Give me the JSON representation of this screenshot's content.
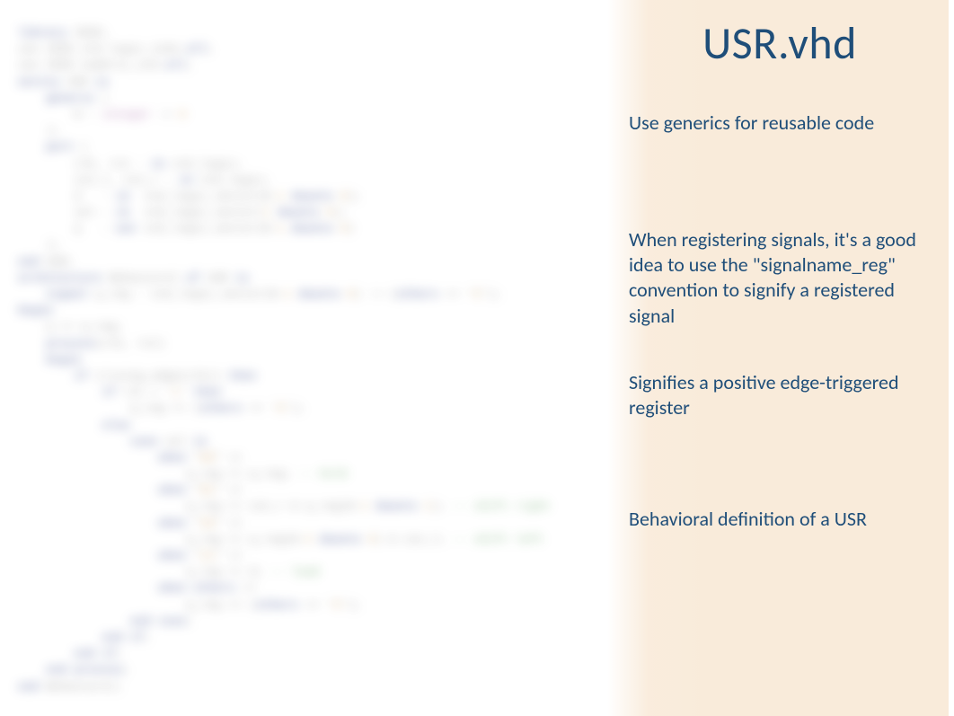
{
  "slide": {
    "title": "USR.vhd",
    "notes": [
      "Use generics for reusable code",
      "When registering signals, it's a good idea to use the \"signalname_reg\" convention to signify a registered signal",
      "Signifies a positive edge-triggered register",
      "Behavioral definition of a USR"
    ]
  },
  "code_blur": {
    "lines": [
      {
        "indent": 0,
        "segs": [
          {
            "t": "library",
            "c": "kw"
          },
          {
            "t": " IEEE;",
            "c": ""
          }
        ]
      },
      {
        "indent": 0,
        "segs": [
          {
            "t": "use IEEE.std_logic_1164.",
            "c": ""
          },
          {
            "t": "all",
            "c": "kw"
          },
          {
            "t": ";",
            "c": ""
          }
        ]
      },
      {
        "indent": 0,
        "segs": [
          {
            "t": "use IEEE.numeric_std.",
            "c": ""
          },
          {
            "t": "all",
            "c": "kw"
          },
          {
            "t": ";",
            "c": ""
          }
        ]
      },
      {
        "indent": 0,
        "segs": [
          {
            "t": "",
            "c": ""
          }
        ]
      },
      {
        "indent": 0,
        "segs": [
          {
            "t": "entity",
            "c": "kw"
          },
          {
            "t": " USR ",
            "c": ""
          },
          {
            "t": "is",
            "c": "kw"
          }
        ]
      },
      {
        "indent": 2,
        "segs": [
          {
            "t": "generic",
            "c": "kw"
          },
          {
            "t": " (",
            "c": ""
          }
        ]
      },
      {
        "indent": 4,
        "segs": [
          {
            "t": "N : ",
            "c": ""
          },
          {
            "t": "integer",
            "c": "type"
          },
          {
            "t": " := ",
            "c": ""
          },
          {
            "t": "8",
            "c": "num"
          }
        ]
      },
      {
        "indent": 2,
        "segs": [
          {
            "t": ");",
            "c": ""
          }
        ]
      },
      {
        "indent": 2,
        "segs": [
          {
            "t": "port",
            "c": "kw"
          },
          {
            "t": " (",
            "c": ""
          }
        ]
      },
      {
        "indent": 4,
        "segs": [
          {
            "t": "clk, rst : ",
            "c": ""
          },
          {
            "t": "in",
            "c": "kw"
          },
          {
            "t": " std_logic;",
            "c": ""
          }
        ]
      },
      {
        "indent": 4,
        "segs": [
          {
            "t": "sin_l, sin_r : ",
            "c": ""
          },
          {
            "t": "in",
            "c": "kw"
          },
          {
            "t": " std_logic;",
            "c": ""
          }
        ]
      },
      {
        "indent": 4,
        "segs": [
          {
            "t": "d   : ",
            "c": ""
          },
          {
            "t": "in",
            "c": "kw"
          },
          {
            "t": "  std_logic_vector(N-",
            "c": ""
          },
          {
            "t": "1",
            "c": "num"
          },
          {
            "t": " downto ",
            "c": "kw"
          },
          {
            "t": "0",
            "c": "num"
          },
          {
            "t": ");",
            "c": ""
          }
        ]
      },
      {
        "indent": 4,
        "segs": [
          {
            "t": "sel : ",
            "c": ""
          },
          {
            "t": "in",
            "c": "kw"
          },
          {
            "t": "  std_logic_vector(",
            "c": ""
          },
          {
            "t": "1",
            "c": "num"
          },
          {
            "t": " downto ",
            "c": "kw"
          },
          {
            "t": "0",
            "c": "num"
          },
          {
            "t": ");",
            "c": ""
          }
        ]
      },
      {
        "indent": 4,
        "segs": [
          {
            "t": "q   : ",
            "c": ""
          },
          {
            "t": "out",
            "c": "kw"
          },
          {
            "t": " std_logic_vector(N-",
            "c": ""
          },
          {
            "t": "1",
            "c": "num"
          },
          {
            "t": " downto ",
            "c": "kw"
          },
          {
            "t": "0",
            "c": "num"
          },
          {
            "t": ")",
            "c": ""
          }
        ]
      },
      {
        "indent": 2,
        "segs": [
          {
            "t": ");",
            "c": ""
          }
        ]
      },
      {
        "indent": 0,
        "segs": [
          {
            "t": "end",
            "c": "kw"
          },
          {
            "t": " USR;",
            "c": ""
          }
        ]
      },
      {
        "indent": 0,
        "segs": [
          {
            "t": "",
            "c": ""
          }
        ]
      },
      {
        "indent": 0,
        "segs": [
          {
            "t": "architecture",
            "c": "kw"
          },
          {
            "t": " Behavioral ",
            "c": ""
          },
          {
            "t": "of",
            "c": "kw"
          },
          {
            "t": " USR ",
            "c": ""
          },
          {
            "t": "is",
            "c": "kw"
          }
        ]
      },
      {
        "indent": 0,
        "segs": [
          {
            "t": "",
            "c": ""
          }
        ]
      },
      {
        "indent": 2,
        "segs": [
          {
            "t": "signal",
            "c": "kw"
          },
          {
            "t": " q_reg : std_logic_vector(N-",
            "c": ""
          },
          {
            "t": "1",
            "c": "num"
          },
          {
            "t": " downto ",
            "c": "kw"
          },
          {
            "t": "0",
            "c": "num"
          },
          {
            "t": ") := (",
            "c": ""
          },
          {
            "t": "others",
            "c": "kw"
          },
          {
            "t": " => '",
            "c": ""
          },
          {
            "t": "0",
            "c": "num"
          },
          {
            "t": "');",
            "c": ""
          }
        ]
      },
      {
        "indent": 0,
        "segs": [
          {
            "t": "",
            "c": ""
          }
        ]
      },
      {
        "indent": 0,
        "segs": [
          {
            "t": "begin",
            "c": "kw"
          }
        ]
      },
      {
        "indent": 0,
        "segs": [
          {
            "t": "",
            "c": ""
          }
        ]
      },
      {
        "indent": 2,
        "segs": [
          {
            "t": "q <= q_reg;",
            "c": ""
          }
        ]
      },
      {
        "indent": 0,
        "segs": [
          {
            "t": "",
            "c": ""
          }
        ]
      },
      {
        "indent": 2,
        "segs": [
          {
            "t": "process",
            "c": "kw"
          },
          {
            "t": "(clk, rst)",
            "c": ""
          }
        ]
      },
      {
        "indent": 2,
        "segs": [
          {
            "t": "begin",
            "c": "kw"
          }
        ]
      },
      {
        "indent": 4,
        "segs": [
          {
            "t": "if",
            "c": "kw"
          },
          {
            "t": " (rising_edge(clk)) ",
            "c": ""
          },
          {
            "t": "then",
            "c": "kw"
          }
        ]
      },
      {
        "indent": 6,
        "segs": [
          {
            "t": "if",
            "c": "kw"
          },
          {
            "t": " rst = '",
            "c": ""
          },
          {
            "t": "1",
            "c": "num"
          },
          {
            "t": "' ",
            "c": ""
          },
          {
            "t": "then",
            "c": "kw"
          }
        ]
      },
      {
        "indent": 8,
        "segs": [
          {
            "t": "q_reg <= (",
            "c": ""
          },
          {
            "t": "others",
            "c": "kw"
          },
          {
            "t": " => '",
            "c": ""
          },
          {
            "t": "0",
            "c": "num"
          },
          {
            "t": "');",
            "c": ""
          }
        ]
      },
      {
        "indent": 6,
        "segs": [
          {
            "t": "else",
            "c": "kw"
          }
        ]
      },
      {
        "indent": 8,
        "segs": [
          {
            "t": "case",
            "c": "kw"
          },
          {
            "t": " sel ",
            "c": ""
          },
          {
            "t": "is",
            "c": "kw"
          }
        ]
      },
      {
        "indent": 10,
        "segs": [
          {
            "t": "when",
            "c": "kw"
          },
          {
            "t": " \"",
            "c": ""
          },
          {
            "t": "00",
            "c": "num"
          },
          {
            "t": "\" =>",
            "c": ""
          }
        ]
      },
      {
        "indent": 12,
        "segs": [
          {
            "t": "q_reg <= q_reg; ",
            "c": ""
          },
          {
            "t": "-- hold",
            "c": "cmt"
          }
        ]
      },
      {
        "indent": 10,
        "segs": [
          {
            "t": "when",
            "c": "kw"
          },
          {
            "t": " \"",
            "c": ""
          },
          {
            "t": "01",
            "c": "num"
          },
          {
            "t": "\" =>",
            "c": ""
          }
        ]
      },
      {
        "indent": 12,
        "segs": [
          {
            "t": "q_reg <= sin_r & q_reg(N-",
            "c": ""
          },
          {
            "t": "1",
            "c": "num"
          },
          {
            "t": " downto ",
            "c": "kw"
          },
          {
            "t": "1",
            "c": "num"
          },
          {
            "t": "); ",
            "c": ""
          },
          {
            "t": "-- shift right",
            "c": "cmt"
          }
        ]
      },
      {
        "indent": 10,
        "segs": [
          {
            "t": "when",
            "c": "kw"
          },
          {
            "t": " \"",
            "c": ""
          },
          {
            "t": "10",
            "c": "num"
          },
          {
            "t": "\" =>",
            "c": ""
          }
        ]
      },
      {
        "indent": 12,
        "segs": [
          {
            "t": "q_reg <= q_reg(N-",
            "c": ""
          },
          {
            "t": "2",
            "c": "num"
          },
          {
            "t": " downto ",
            "c": "kw"
          },
          {
            "t": "0",
            "c": "num"
          },
          {
            "t": ") & sin_l; ",
            "c": ""
          },
          {
            "t": "-- shift left",
            "c": "cmt"
          }
        ]
      },
      {
        "indent": 10,
        "segs": [
          {
            "t": "when",
            "c": "kw"
          },
          {
            "t": " \"",
            "c": ""
          },
          {
            "t": "11",
            "c": "num"
          },
          {
            "t": "\" =>",
            "c": ""
          }
        ]
      },
      {
        "indent": 12,
        "segs": [
          {
            "t": "q_reg <= d; ",
            "c": ""
          },
          {
            "t": "-- load",
            "c": "cmt"
          }
        ]
      },
      {
        "indent": 10,
        "segs": [
          {
            "t": "when",
            "c": "kw"
          },
          {
            "t": " ",
            "c": ""
          },
          {
            "t": "others",
            "c": "kw"
          },
          {
            "t": " =>",
            "c": ""
          }
        ]
      },
      {
        "indent": 12,
        "segs": [
          {
            "t": "q_reg <= (",
            "c": ""
          },
          {
            "t": "others",
            "c": "kw"
          },
          {
            "t": " => '",
            "c": ""
          },
          {
            "t": "0",
            "c": "num"
          },
          {
            "t": "');",
            "c": ""
          }
        ]
      },
      {
        "indent": 8,
        "segs": [
          {
            "t": "end",
            "c": "kw"
          },
          {
            "t": " ",
            "c": ""
          },
          {
            "t": "case",
            "c": "kw"
          },
          {
            "t": ";",
            "c": ""
          }
        ]
      },
      {
        "indent": 6,
        "segs": [
          {
            "t": "end",
            "c": "kw"
          },
          {
            "t": " ",
            "c": ""
          },
          {
            "t": "if",
            "c": "kw"
          },
          {
            "t": ";",
            "c": ""
          }
        ]
      },
      {
        "indent": 4,
        "segs": [
          {
            "t": "end",
            "c": "kw"
          },
          {
            "t": " ",
            "c": ""
          },
          {
            "t": "if",
            "c": "kw"
          },
          {
            "t": ";",
            "c": ""
          }
        ]
      },
      {
        "indent": 2,
        "segs": [
          {
            "t": "end",
            "c": "kw"
          },
          {
            "t": " ",
            "c": ""
          },
          {
            "t": "process",
            "c": "kw"
          },
          {
            "t": ";",
            "c": ""
          }
        ]
      },
      {
        "indent": 0,
        "segs": [
          {
            "t": "",
            "c": ""
          }
        ]
      },
      {
        "indent": 0,
        "segs": [
          {
            "t": "end",
            "c": "kw"
          },
          {
            "t": " Behavioral;",
            "c": ""
          }
        ]
      }
    ]
  }
}
